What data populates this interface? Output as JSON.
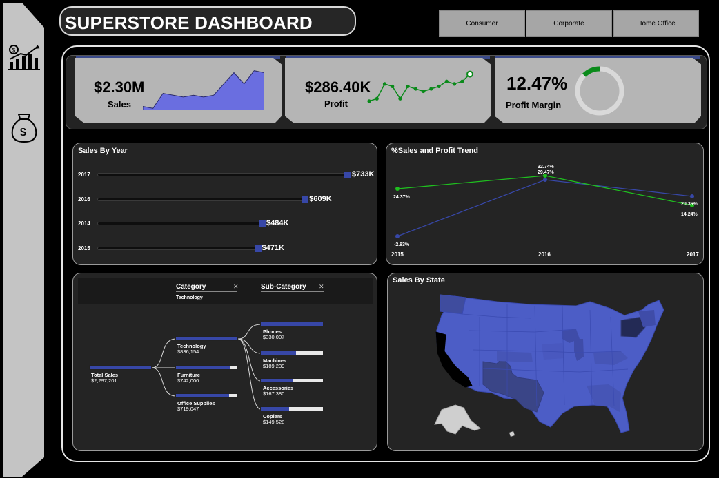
{
  "header": {
    "title": "SUPERSTORE DASHBOARD"
  },
  "sidebar": {
    "icons": [
      "growth-chart-icon",
      "money-bag-icon"
    ]
  },
  "segments": [
    "Consumer",
    "Corporate",
    "Home Office"
  ],
  "kpis": {
    "sales": {
      "value": "$2.30M",
      "label": "Sales"
    },
    "profit": {
      "value": "$286.40K",
      "label": "Profit"
    },
    "margin": {
      "value": "12.47%",
      "label": "Profit Margin",
      "fraction": 0.1247
    }
  },
  "colors": {
    "accent": "#3747a7",
    "green": "#1fbf1f",
    "kpi_bg": "#b5b5b5",
    "panel_bg": "#242424",
    "sparkline_fill": "#6a6ee0"
  },
  "sales_by_year": {
    "title": "Sales By Year",
    "rows": [
      {
        "year": "2017",
        "value": 733,
        "label": "$733K"
      },
      {
        "year": "2016",
        "value": 609,
        "label": "$609K"
      },
      {
        "year": "2014",
        "value": 484,
        "label": "$484K"
      },
      {
        "year": "2015",
        "value": 471,
        "label": "$471K"
      }
    ]
  },
  "trend": {
    "title": "%Sales and Profit Trend",
    "years": [
      "2015",
      "2016",
      "2017"
    ],
    "labels": [
      "24.37%",
      "-2.83%",
      "32.74%",
      "29.47%",
      "20.36%",
      "14.24%"
    ]
  },
  "decomposition": {
    "filters": [
      {
        "label": "Category",
        "selected": "Technology"
      },
      {
        "label": "Sub-Category",
        "selected": ""
      }
    ],
    "root": {
      "name": "Total Sales",
      "value": "$2,297,201"
    },
    "categories": [
      {
        "name": "Technology",
        "value": "$836,154",
        "fraction": 1.0
      },
      {
        "name": "Furniture",
        "value": "$742,000",
        "fraction": 0.89
      },
      {
        "name": "Office Supplies",
        "value": "$719,047",
        "fraction": 0.86
      }
    ],
    "subcategories": [
      {
        "name": "Phones",
        "value": "$330,007",
        "fraction": 1.0
      },
      {
        "name": "Machines",
        "value": "$189,239",
        "fraction": 0.57
      },
      {
        "name": "Accessories",
        "value": "$167,380",
        "fraction": 0.51
      },
      {
        "name": "Copiers",
        "value": "$149,528",
        "fraction": 0.45
      }
    ]
  },
  "map": {
    "title": "Sales By State"
  },
  "chart_data": [
    {
      "type": "bar",
      "title": "Sales By Year",
      "categories": [
        "2017",
        "2016",
        "2014",
        "2015"
      ],
      "values": [
        733,
        609,
        484,
        471
      ],
      "ylabel": "",
      "xlabel": ""
    },
    {
      "type": "line",
      "title": "%Sales and Profit Trend",
      "x": [
        "2015",
        "2016",
        "2017"
      ],
      "series": [
        {
          "values": [
            -2.83,
            32.74,
            20.36
          ],
          "color": "#3747a7"
        },
        {
          "values": [
            24.37,
            29.47,
            14.24
          ],
          "color": "#1fbf1f"
        }
      ],
      "ylim": [
        -5,
        35
      ]
    },
    {
      "type": "area",
      "title": "",
      "values": [
        2,
        1,
        9,
        8,
        7,
        8,
        7,
        8,
        14,
        20,
        14,
        21,
        20
      ]
    },
    {
      "type": "line",
      "title": "",
      "values": [
        2,
        3,
        9,
        8,
        3,
        8,
        7,
        6,
        7,
        8,
        10,
        9,
        10,
        13
      ]
    }
  ]
}
